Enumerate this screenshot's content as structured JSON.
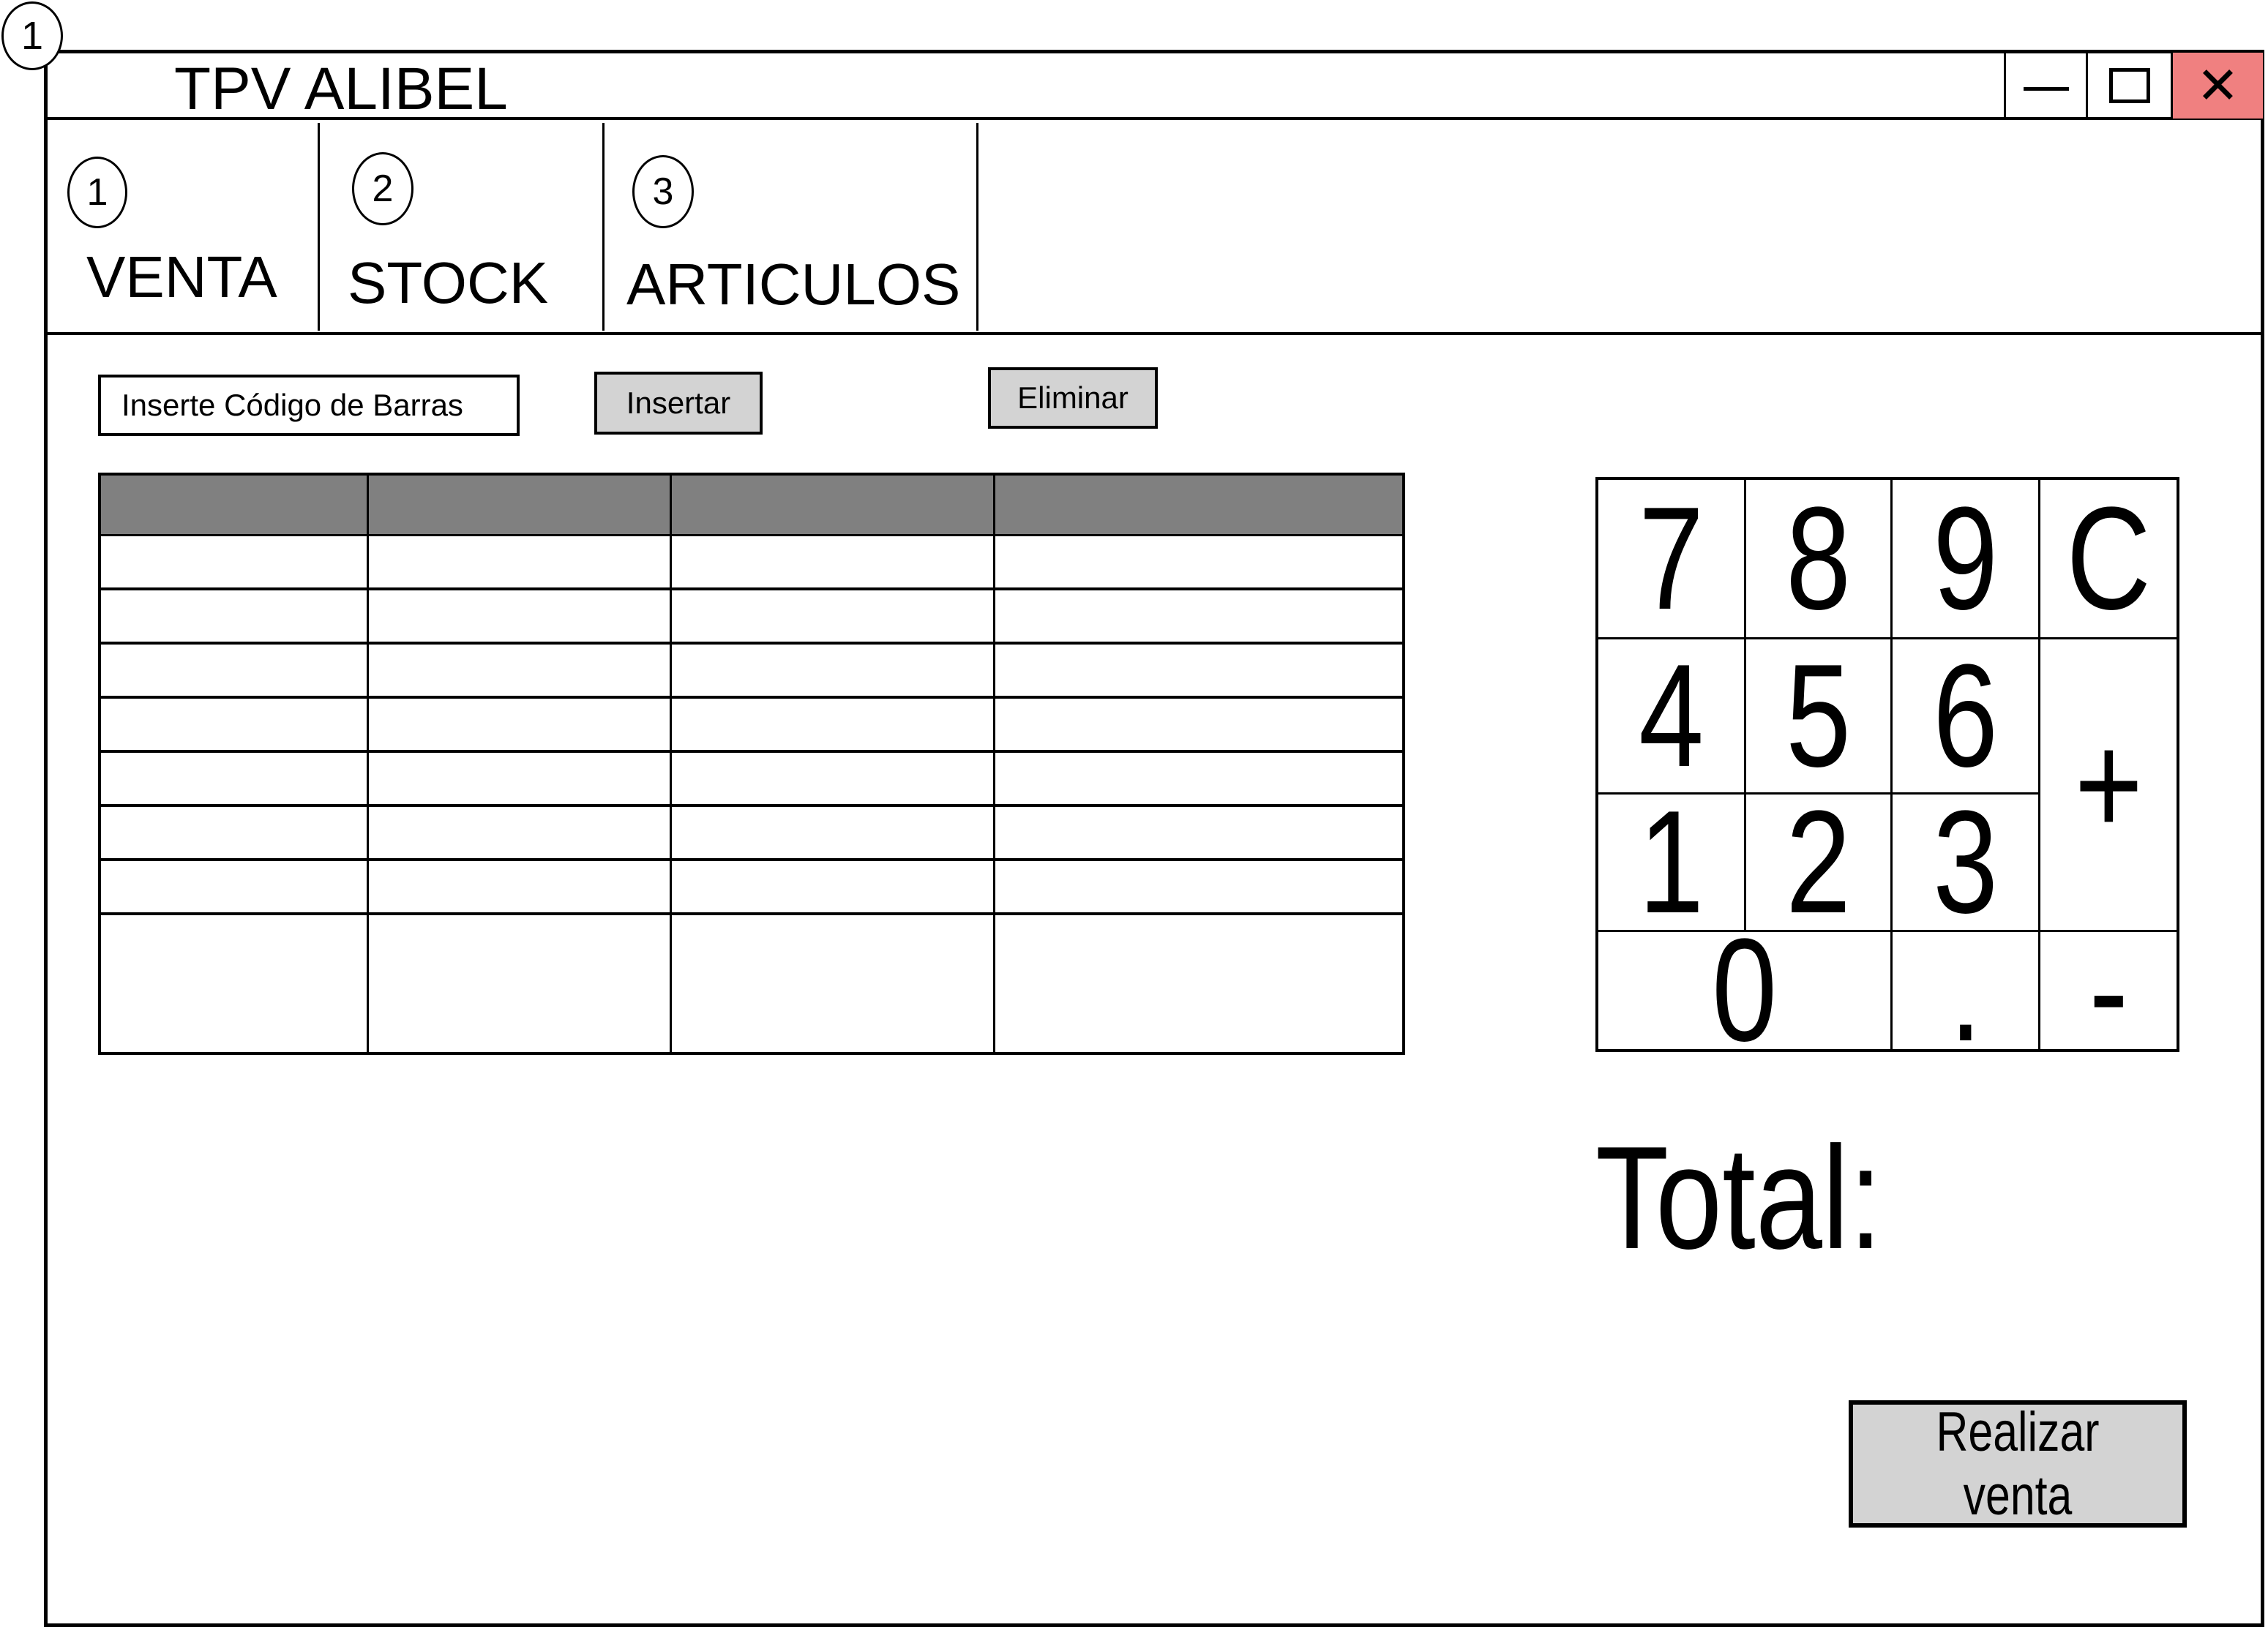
{
  "screen_marker": "1",
  "window": {
    "title": "TPV ALIBEL",
    "controls": {
      "minimize_icon": "minimize-icon",
      "maximize_icon": "maximize-icon",
      "close_icon": "close-icon",
      "close_glyph": "✕",
      "close_color": "#f08080"
    }
  },
  "tabs": [
    {
      "number": "1",
      "label": "VENTA"
    },
    {
      "number": "2",
      "label": "STOCK"
    },
    {
      "number": "3",
      "label": "ARTICULOS"
    }
  ],
  "sale": {
    "barcode_placeholder": "Inserte Código de Barras",
    "insert_label": "Insertar",
    "delete_label": "Eliminar",
    "table": {
      "header_color": "#808080",
      "columns": [
        "",
        "",
        "",
        ""
      ],
      "rows": [
        [
          "",
          "",
          "",
          ""
        ],
        [
          "",
          "",
          "",
          ""
        ],
        [
          "",
          "",
          "",
          ""
        ],
        [
          "",
          "",
          "",
          ""
        ],
        [
          "",
          "",
          "",
          ""
        ],
        [
          "",
          "",
          "",
          ""
        ],
        [
          "",
          "",
          "",
          ""
        ],
        [
          "",
          "",
          "",
          ""
        ]
      ]
    },
    "keypad": {
      "k7": "7",
      "k8": "8",
      "k9": "9",
      "clear": "C",
      "k4": "4",
      "k5": "5",
      "k6": "6",
      "plus": "+",
      "k1": "1",
      "k2": "2",
      "k3": "3",
      "k0": "0",
      "dot": ".",
      "minus": "-"
    },
    "total_label": "Total:",
    "submit_label": "Realizar venta",
    "button_color": "#d3d3d3"
  }
}
